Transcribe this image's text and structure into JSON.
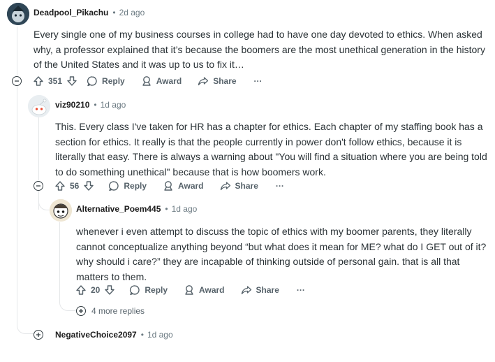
{
  "comments": [
    {
      "author": "Deadpool_Pikachu",
      "time": "2d ago",
      "body": "Every single one of my business courses in college had to have one day devoted to ethics. When asked why, a professor explained that it’s because the boomers are the most unethical generation in the history of the United States and it was up to us to fix it…",
      "score": "351"
    },
    {
      "author": "viz90210",
      "time": "1d ago",
      "body": "This. Every class I've taken for HR has a chapter for ethics. Each chapter of my staffing book has a section for ethics. It really is that the people currently in power don't follow ethics, because it is literally that easy. There is always a warning about \"You will find a situation where you are being told to do something unethical\" because that is how boomers work.",
      "score": "56"
    },
    {
      "author": "Alternative_Poem445",
      "time": "1d ago",
      "body": "whenever i even attempt to discuss the topic of ethics with my boomer parents, they literally cannot conceptualize anything beyond “but what does it mean for ME? what do I GET out of it? why should i care?” they are incapable of thinking outside of personal gain. that is all that matters to them.",
      "score": "20"
    },
    {
      "author": "NegativeChoice2097",
      "time": "1d ago"
    }
  ],
  "actions": {
    "reply": "Reply",
    "award": "Award",
    "share": "Share",
    "more": "···"
  },
  "separator": "•",
  "more_replies": "4 more replies"
}
